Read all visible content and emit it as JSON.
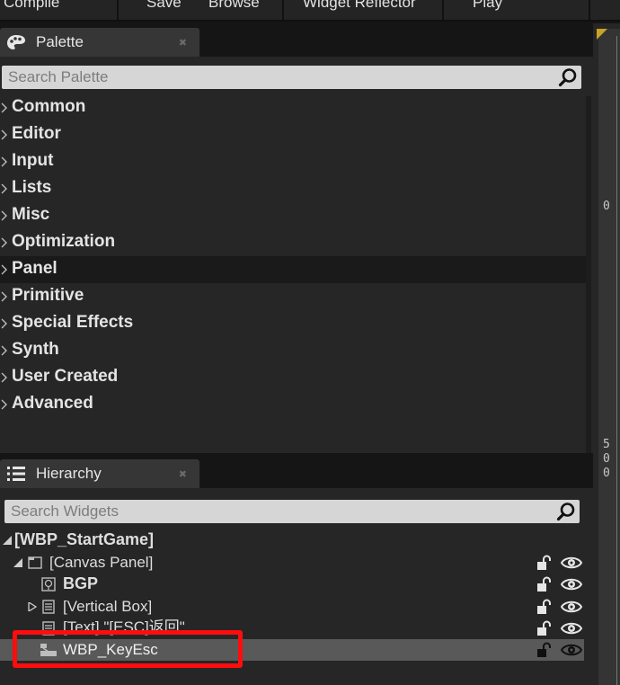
{
  "toolbar": {
    "compile": "Compile",
    "save": "Save",
    "browse": "Browse",
    "widget_reflector": "Widget Reflector",
    "play": "Play"
  },
  "palette": {
    "tab_label": "Palette",
    "search_placeholder": "Search Palette",
    "categories": [
      {
        "label": "Common",
        "active": false
      },
      {
        "label": "Editor",
        "active": false
      },
      {
        "label": "Input",
        "active": false
      },
      {
        "label": "Lists",
        "active": false
      },
      {
        "label": "Misc",
        "active": false
      },
      {
        "label": "Optimization",
        "active": false
      },
      {
        "label": "Panel",
        "active": true
      },
      {
        "label": "Primitive",
        "active": false
      },
      {
        "label": "Special Effects",
        "active": false
      },
      {
        "label": "Synth",
        "active": false
      },
      {
        "label": "User Created",
        "active": false
      },
      {
        "label": "Advanced",
        "active": false
      }
    ]
  },
  "hierarchy": {
    "tab_label": "Hierarchy",
    "search_placeholder": "Search Widgets",
    "root": "[WBP_StartGame]",
    "canvas_panel": "[Canvas Panel]",
    "bgp": "BGP",
    "vertical_box": "[Vertical Box]",
    "text_item": "[Text] \"[ESC]返回\"",
    "key_esc": "WBP_KeyEsc"
  },
  "ruler": {
    "top_value": "0",
    "mid_value": [
      "5",
      "0",
      "0"
    ]
  },
  "colors": {
    "highlight": "#ff0d0d",
    "selected_row": "#595959",
    "active_category": "#1a1a1a"
  },
  "icons": {
    "palette": "palette-icon",
    "hierarchy": "hierarchy-icon",
    "search": "search-icon",
    "lock": "lock-icon",
    "eye": "eye-icon"
  }
}
